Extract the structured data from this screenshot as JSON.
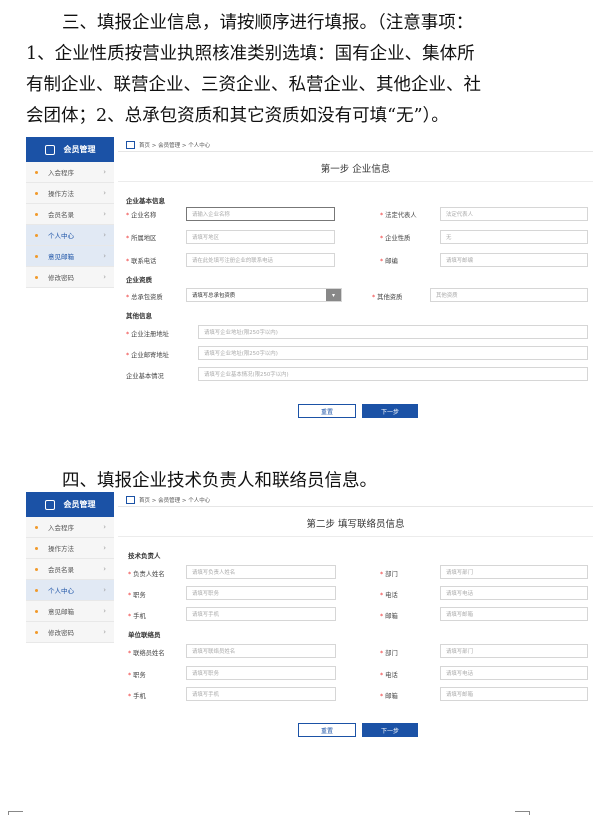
{
  "instructions": {
    "step3_line1": "三、填报企业信息，请按顺序进行填报。（注意事项：",
    "step3_line2": "1、企业性质按营业执照核准类别选填：国有企业、集体所",
    "step3_line3": "有制企业、联营企业、三资企业、私营企业、其他企业、社",
    "step3_line4": "会团体；2、总承包资质和其它资质如没有可填“无”）。",
    "step4": "四、填报企业技术负责人和联络员信息。"
  },
  "sidebar": {
    "title": "会员管理",
    "items": [
      {
        "label": "入会程序"
      },
      {
        "label": "操作方法"
      },
      {
        "label": "会员名录"
      },
      {
        "label": "个人中心"
      },
      {
        "label": "意见邮箱"
      },
      {
        "label": "修改密码"
      }
    ]
  },
  "breadcrumb": "首页 > 会员管理 > 个人中心",
  "screen1": {
    "step_title": "第一步 企业信息",
    "basic_section": "企业基本信息",
    "company_name": {
      "label": "企业名称",
      "placeholder": "请输入企业名称"
    },
    "legal_rep": {
      "label": "法定代表人",
      "placeholder": "法定代表人"
    },
    "region": {
      "label": "所属地区",
      "placeholder": "请填写地区"
    },
    "nature": {
      "label": "企业性质",
      "value": "无"
    },
    "phone": {
      "label": "联系电话",
      "placeholder": "请在此处填写注册企业的联系电话"
    },
    "email": {
      "label": "邮编",
      "placeholder": "请填写邮编"
    },
    "qual_section": "企业资质",
    "general_qual": {
      "label": "总承包资质",
      "value": "请填写总承包资质"
    },
    "other_qual": {
      "label": "其他资质",
      "placeholder": "其他资质"
    },
    "other_section": "其他信息",
    "reg_address": {
      "label": "企业注册地址",
      "placeholder": "请填写企业地址(限250字以内)"
    },
    "mail_address": {
      "label": "企业邮寄地址",
      "placeholder": "请填写企业地址(限250字以内)"
    },
    "basic_info": {
      "label": "企业基本情况",
      "placeholder": "请填写企业基本情况(限250字以内)"
    },
    "reset": "重置",
    "next": "下一步"
  },
  "screen2": {
    "step_title": "第二步 填写联络员信息",
    "tech_section": "技术负责人",
    "tech_name": {
      "label": "负责人姓名",
      "placeholder": "请填写负责人姓名"
    },
    "tech_dept": {
      "label": "部门",
      "placeholder": "请填写部门"
    },
    "tech_title": {
      "label": "职务",
      "placeholder": "请填写职务"
    },
    "tech_phone": {
      "label": "电话",
      "placeholder": "请填写电话"
    },
    "tech_mobile": {
      "label": "手机",
      "placeholder": "请填写手机"
    },
    "tech_email": {
      "label": "邮箱",
      "placeholder": "请填写邮箱"
    },
    "contact_section": "单位联络员",
    "c_name": {
      "label": "联络员姓名",
      "placeholder": "请填写联络员姓名"
    },
    "c_dept": {
      "label": "部门",
      "placeholder": "请填写部门"
    },
    "c_title": {
      "label": "职务",
      "placeholder": "请填写职务"
    },
    "c_phone": {
      "label": "电话",
      "placeholder": "请填写电话"
    },
    "c_mobile": {
      "label": "手机",
      "placeholder": "请填写手机"
    },
    "c_email": {
      "label": "邮箱",
      "placeholder": "请填写邮箱"
    },
    "reset": "重置",
    "next": "下一步"
  }
}
